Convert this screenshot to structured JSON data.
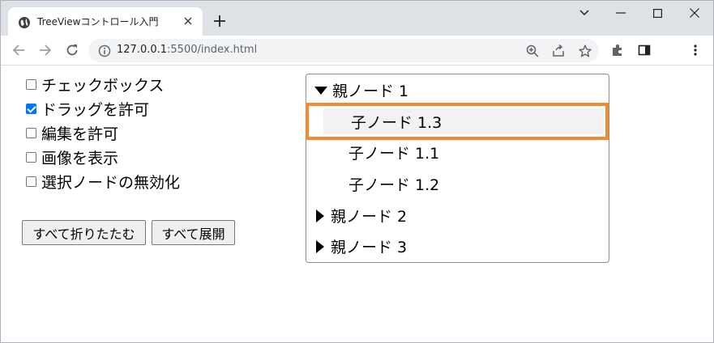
{
  "browser": {
    "tab_title": "TreeViewコントロール入門",
    "url_host": "127.0.0.1",
    "url_rest": ":5500/index.html"
  },
  "options": [
    {
      "label": "チェックボックス",
      "checked": false
    },
    {
      "label": "ドラッグを許可",
      "checked": true
    },
    {
      "label": "編集を許可",
      "checked": false
    },
    {
      "label": "画像を表示",
      "checked": false
    },
    {
      "label": "選択ノードの無効化",
      "checked": false
    }
  ],
  "buttons": {
    "collapse_all": "すべて折りたたむ",
    "expand_all": "すべて展開"
  },
  "tree": {
    "nodes": [
      {
        "label": "親ノード 1",
        "expanded": true
      },
      {
        "label": "子ノード 1.3",
        "selected": true
      },
      {
        "label": "子ノード 1.1"
      },
      {
        "label": "子ノード 1.2"
      },
      {
        "label": "親ノード 2",
        "expanded": false
      },
      {
        "label": "親ノード 3",
        "expanded": false
      }
    ]
  },
  "colors": {
    "highlight_border": "#f58a2e",
    "checkbox_checked": "#0075ff"
  }
}
